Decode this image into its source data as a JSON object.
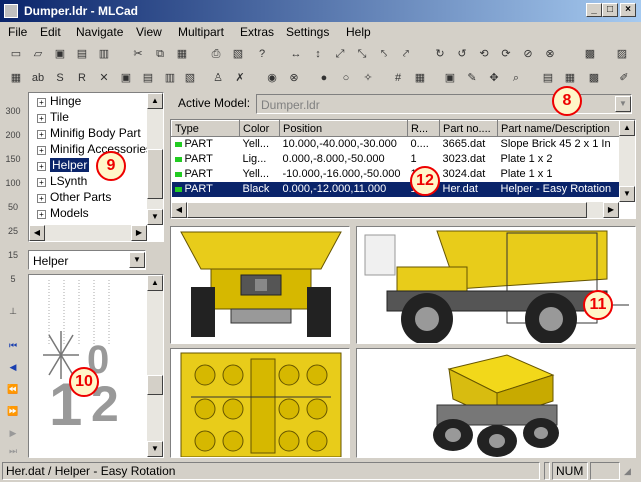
{
  "window": {
    "title": "Dumper.ldr - MLCad"
  },
  "menu": [
    "File",
    "Edit",
    "Navigate",
    "View",
    "Multipart",
    "Extras",
    "Settings",
    "Help"
  ],
  "tree": {
    "items": [
      {
        "label": "Hinge",
        "state": "+"
      },
      {
        "label": "Tile",
        "state": "+"
      },
      {
        "label": "Minifig Body Part",
        "state": "+"
      },
      {
        "label": "Minifig Accessories",
        "state": "+"
      },
      {
        "label": "Helper",
        "state": "+",
        "selected": true
      },
      {
        "label": "LSynth",
        "state": "+"
      },
      {
        "label": "Other Parts",
        "state": "+"
      },
      {
        "label": "Models",
        "state": "+"
      }
    ]
  },
  "preview": {
    "category": "Helper"
  },
  "active_model": {
    "label": "Active Model:",
    "value": "Dumper.ldr"
  },
  "parts_table": {
    "columns": [
      "Type",
      "Color",
      "Position",
      "R...",
      "Part no....",
      "Part name/Description"
    ],
    "rows": [
      [
        "PART",
        "Yell...",
        "10.000,-40.000,-30.000",
        "0....",
        "3665.dat",
        "Slope Brick 45 2 x 1 In"
      ],
      [
        "PART",
        "Lig...",
        "0.000,-8.000,-50.000",
        "1",
        "3023.dat",
        "Plate 1 x 2"
      ],
      [
        "PART",
        "Yell...",
        "-10.000,-16.000,-50.000",
        "1",
        "3024.dat",
        "Plate 1 x 1"
      ],
      [
        "PART",
        "Black",
        "0.000,-12.000,11.000",
        "1",
        "Her.dat",
        "Helper - Easy Rotation"
      ]
    ],
    "selected_row": 3
  },
  "badges": {
    "b8": "8",
    "b9": "9",
    "b10": "10",
    "b11": "11",
    "b12": "12"
  },
  "left_tools": [
    "300",
    "200",
    "150",
    "100",
    "50",
    "25",
    "15",
    "5"
  ],
  "status": {
    "text": "Her.dat / Helper - Easy Rotation",
    "num": "NUM"
  },
  "colors": {
    "title_bar": "#0a246a",
    "selection": "#0a246a",
    "badge": "#e00000"
  }
}
